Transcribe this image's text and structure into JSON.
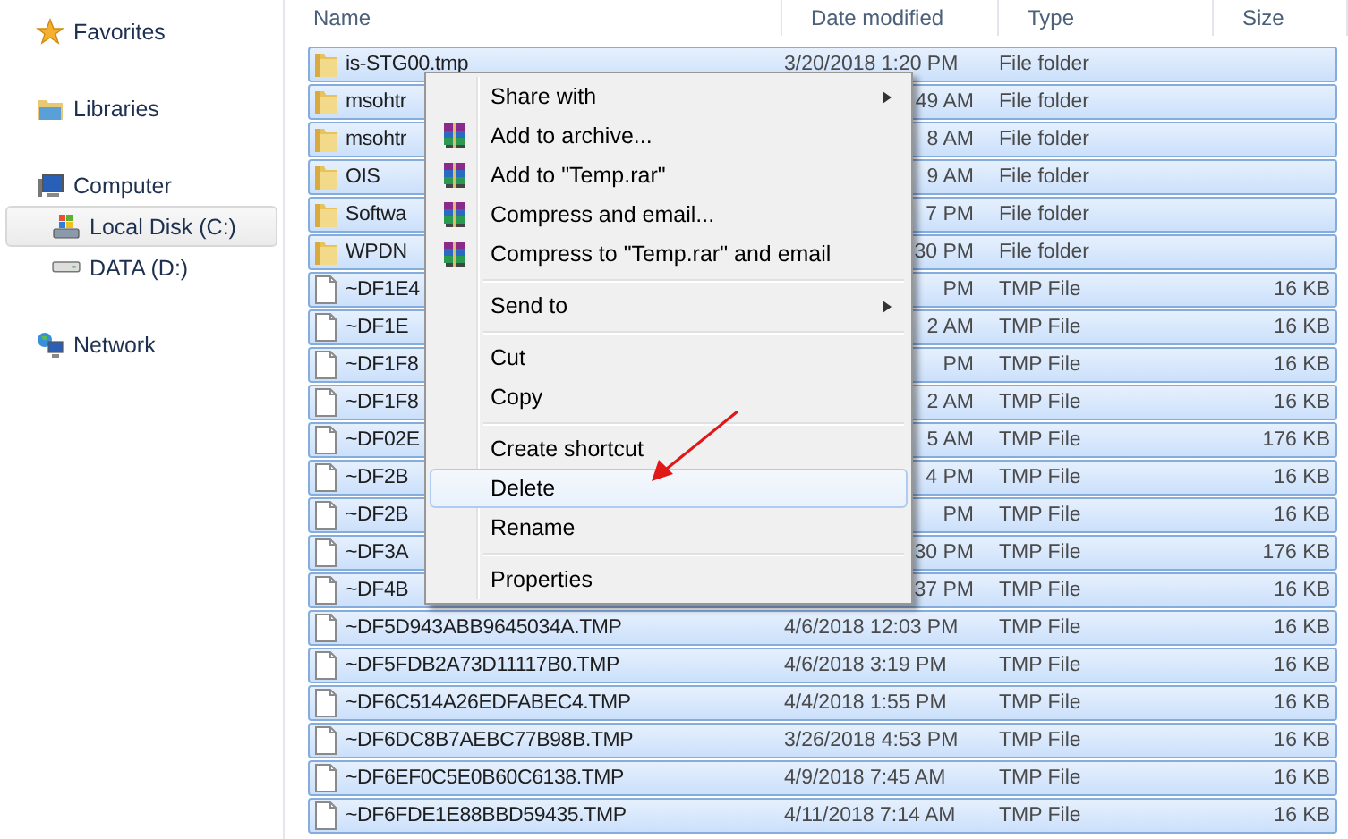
{
  "sidebar": {
    "items": [
      {
        "label": "Favorites",
        "kind": "favorites",
        "selected": false
      },
      {
        "label": "Libraries",
        "kind": "libraries",
        "selected": false
      },
      {
        "label": "Computer",
        "kind": "computer",
        "selected": false,
        "children": [
          {
            "label": "Local Disk (C:)",
            "kind": "system-drive",
            "selected": true
          },
          {
            "label": "DATA (D:)",
            "kind": "drive",
            "selected": false
          }
        ]
      },
      {
        "label": "Network",
        "kind": "network",
        "selected": false
      }
    ]
  },
  "table": {
    "columns": [
      "Name",
      "Date modified",
      "Type",
      "Size"
    ],
    "rows": [
      {
        "kind": "folder",
        "name": "is-STG00.tmp",
        "date": "3/20/2018 1:20 PM",
        "type": "File folder",
        "size": "",
        "selected": true
      },
      {
        "kind": "folder",
        "name": "msohtr",
        "date": "49 AM",
        "type": "File folder",
        "size": "",
        "selected": true
      },
      {
        "kind": "folder",
        "name": "msohtr",
        "date": "8 AM",
        "type": "File folder",
        "size": "",
        "selected": true
      },
      {
        "kind": "folder",
        "name": "OIS",
        "date": "9 AM",
        "type": "File folder",
        "size": "",
        "selected": true
      },
      {
        "kind": "folder",
        "name": "Softwa",
        "date": "7 PM",
        "type": "File folder",
        "size": "",
        "selected": true
      },
      {
        "kind": "folder",
        "name": "WPDN",
        "date": "30 PM",
        "type": "File folder",
        "size": "",
        "selected": true
      },
      {
        "kind": "file",
        "name": "~DF1E4",
        "date": "PM",
        "type": "TMP File",
        "size": "16 KB",
        "selected": true
      },
      {
        "kind": "file",
        "name": "~DF1E",
        "date": "2 AM",
        "type": "TMP File",
        "size": "16 KB",
        "selected": true
      },
      {
        "kind": "file",
        "name": "~DF1F8",
        "date": "PM",
        "type": "TMP File",
        "size": "16 KB",
        "selected": true
      },
      {
        "kind": "file",
        "name": "~DF1F8",
        "date": "2 AM",
        "type": "TMP File",
        "size": "16 KB",
        "selected": true
      },
      {
        "kind": "file",
        "name": "~DF02E",
        "date": "5 AM",
        "type": "TMP File",
        "size": "176 KB",
        "selected": true
      },
      {
        "kind": "file",
        "name": "~DF2B",
        "date": "4 PM",
        "type": "TMP File",
        "size": "16 KB",
        "selected": true
      },
      {
        "kind": "file",
        "name": "~DF2B",
        "date": "PM",
        "type": "TMP File",
        "size": "16 KB",
        "selected": true
      },
      {
        "kind": "file",
        "name": "~DF3A",
        "date": "30 PM",
        "type": "TMP File",
        "size": "176 KB",
        "selected": true
      },
      {
        "kind": "file",
        "name": "~DF4B",
        "date": "37 PM",
        "type": "TMP File",
        "size": "16 KB",
        "selected": true
      },
      {
        "kind": "file",
        "name": "~DF5D943ABB9645034A.TMP",
        "date": "4/6/2018 12:03 PM",
        "type": "TMP File",
        "size": "16 KB",
        "selected": true
      },
      {
        "kind": "file",
        "name": "~DF5FDB2A73D11117B0.TMP",
        "date": "4/6/2018 3:19 PM",
        "type": "TMP File",
        "size": "16 KB",
        "selected": true
      },
      {
        "kind": "file",
        "name": "~DF6C514A26EDFABEC4.TMP",
        "date": "4/4/2018 1:55 PM",
        "type": "TMP File",
        "size": "16 KB",
        "selected": true
      },
      {
        "kind": "file",
        "name": "~DF6DC8B7AEBC77B98B.TMP",
        "date": "3/26/2018 4:53 PM",
        "type": "TMP File",
        "size": "16 KB",
        "selected": true
      },
      {
        "kind": "file",
        "name": "~DF6EF0C5E0B60C6138.TMP",
        "date": "4/9/2018 7:45 AM",
        "type": "TMP File",
        "size": "16 KB",
        "selected": true
      },
      {
        "kind": "file",
        "name": "~DF6FDE1E88BBD59435.TMP",
        "date": "4/11/2018 7:14 AM",
        "type": "TMP File",
        "size": "16 KB",
        "selected": true
      }
    ]
  },
  "context_menu": {
    "items": [
      {
        "kind": "submenu",
        "label": "Share with",
        "selected": false
      },
      {
        "kind": "archive",
        "label": "Add to archive...",
        "selected": false
      },
      {
        "kind": "archive",
        "label": "Add to \"Temp.rar\"",
        "selected": false
      },
      {
        "kind": "archive",
        "label": "Compress and email...",
        "selected": false
      },
      {
        "kind": "archive",
        "label": "Compress to \"Temp.rar\" and email",
        "selected": false
      },
      {
        "kind": "separator"
      },
      {
        "kind": "submenu",
        "label": "Send to",
        "selected": false
      },
      {
        "kind": "separator"
      },
      {
        "kind": "plain",
        "label": "Cut",
        "selected": false
      },
      {
        "kind": "plain",
        "label": "Copy",
        "selected": false
      },
      {
        "kind": "separator"
      },
      {
        "kind": "plain",
        "label": "Create shortcut",
        "selected": false
      },
      {
        "kind": "plain",
        "label": "Delete",
        "selected": true
      },
      {
        "kind": "plain",
        "label": "Rename",
        "selected": false
      },
      {
        "kind": "separator"
      },
      {
        "kind": "plain",
        "label": "Properties",
        "selected": false
      }
    ]
  }
}
